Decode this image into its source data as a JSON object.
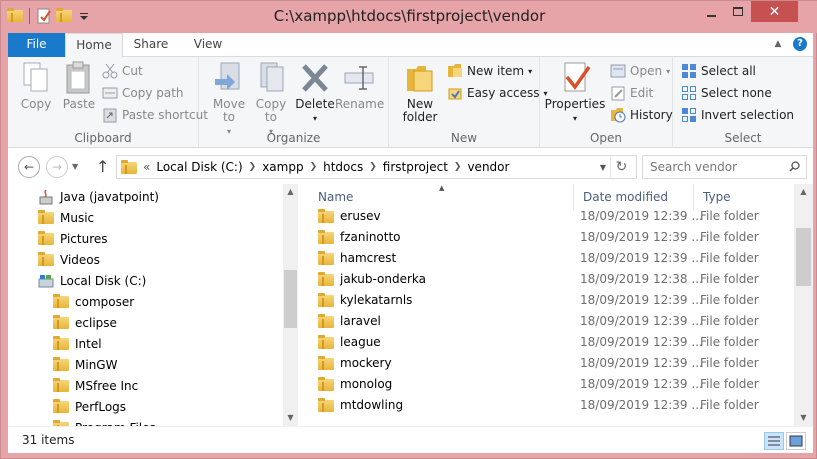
{
  "window": {
    "title": "C:\\xampp\\htdocs\\firstproject\\vendor",
    "close_label": "✕"
  },
  "tabs": {
    "file": "File",
    "home": "Home",
    "share": "Share",
    "view": "View"
  },
  "ribbon": {
    "clipboard": {
      "label": "Clipboard",
      "copy": "Copy",
      "paste": "Paste",
      "cut": "Cut",
      "copy_path": "Copy path",
      "paste_shortcut": "Paste shortcut"
    },
    "organize": {
      "label": "Organize",
      "move_to": "Move to",
      "copy_to": "Copy to",
      "delete": "Delete",
      "rename": "Rename"
    },
    "new": {
      "label": "New",
      "new_folder": "New folder",
      "new_item": "New item",
      "easy_access": "Easy access"
    },
    "open": {
      "label": "Open",
      "properties": "Properties",
      "open": "Open",
      "edit": "Edit",
      "history": "History"
    },
    "select": {
      "label": "Select",
      "select_all": "Select all",
      "select_none": "Select none",
      "invert_selection": "Invert selection"
    }
  },
  "address": {
    "prefix": "«",
    "crumbs": [
      "Local Disk (C:)",
      "xampp",
      "htdocs",
      "firstproject",
      "vendor"
    ]
  },
  "search": {
    "placeholder": "Search vendor"
  },
  "nav_tree": [
    {
      "label": "Java (javatpoint)",
      "icon": "java-icon"
    },
    {
      "label": "Music",
      "icon": "music-folder-icon"
    },
    {
      "label": "Pictures",
      "icon": "pictures-folder-icon"
    },
    {
      "label": "Videos",
      "icon": "videos-folder-icon"
    },
    {
      "label": "Local Disk (C:)",
      "icon": "drive-icon"
    },
    {
      "label": "composer",
      "icon": "folder-icon"
    },
    {
      "label": "eclipse",
      "icon": "folder-icon"
    },
    {
      "label": "Intel",
      "icon": "folder-icon"
    },
    {
      "label": "MinGW",
      "icon": "folder-icon"
    },
    {
      "label": "MSfree Inc",
      "icon": "folder-icon"
    },
    {
      "label": "PerfLogs",
      "icon": "folder-icon"
    },
    {
      "label": "Program Files",
      "icon": "folder-icon"
    }
  ],
  "columns": {
    "name": "Name",
    "date_modified": "Date modified",
    "type": "Type"
  },
  "files": [
    {
      "name": "erusev",
      "date": "18/09/2019 12:39 ...",
      "type": "File folder"
    },
    {
      "name": "fzaninotto",
      "date": "18/09/2019 12:39 ...",
      "type": "File folder"
    },
    {
      "name": "hamcrest",
      "date": "18/09/2019 12:39 ...",
      "type": "File folder"
    },
    {
      "name": "jakub-onderka",
      "date": "18/09/2019 12:38 ...",
      "type": "File folder"
    },
    {
      "name": "kylekatarnls",
      "date": "18/09/2019 12:39 ...",
      "type": "File folder"
    },
    {
      "name": "laravel",
      "date": "18/09/2019 12:39 ...",
      "type": "File folder"
    },
    {
      "name": "league",
      "date": "18/09/2019 12:39 ...",
      "type": "File folder"
    },
    {
      "name": "mockery",
      "date": "18/09/2019 12:39 ...",
      "type": "File folder"
    },
    {
      "name": "monolog",
      "date": "18/09/2019 12:39 ...",
      "type": "File folder"
    },
    {
      "name": "mtdowling",
      "date": "18/09/2019 12:39 ...",
      "type": "File folder"
    }
  ],
  "status": {
    "item_count": "31 items"
  },
  "colors": {
    "title_bar": "#e6a3a8",
    "file_tab": "#1979ca",
    "close_button": "#c75050"
  }
}
